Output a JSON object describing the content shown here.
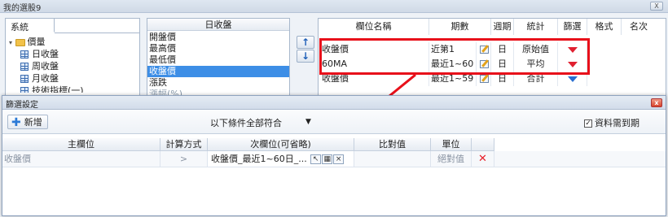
{
  "window": {
    "title": "我的選股9",
    "close_label": "X"
  },
  "left_panel": {
    "tab": "系統",
    "tree": [
      {
        "label": "價量",
        "type": "folder",
        "expanded": true
      },
      {
        "label": "日收盤",
        "type": "table"
      },
      {
        "label": "周收盤",
        "type": "table"
      },
      {
        "label": "月收盤",
        "type": "table"
      },
      {
        "label": "技術指標(一)",
        "type": "table"
      }
    ]
  },
  "middle_panel": {
    "header": "日收盤",
    "items": [
      "開盤價",
      "最高價",
      "最低價",
      "收盤價",
      "漲跌",
      "漲幅(%)"
    ],
    "selected": "收盤價"
  },
  "move_buttons": {
    "up": "↑",
    "down": "↓"
  },
  "right_panel": {
    "columns": [
      "欄位名稱",
      "期數",
      "週期",
      "統計",
      "篩選",
      "格式",
      "名次"
    ],
    "rows": [
      {
        "name": "收盤價",
        "period": "近第1",
        "cycle": "日",
        "stat": "原始值",
        "filter": "red"
      },
      {
        "name": "60MA",
        "period": "最近1~60",
        "cycle": "日",
        "stat": "平均",
        "filter": "red"
      },
      {
        "name": "收盤價",
        "period": "最近1~59",
        "cycle": "日",
        "stat": "合計",
        "filter": "blue"
      }
    ]
  },
  "dialog": {
    "title": "篩選設定",
    "close_label": "x",
    "add_label": "新增",
    "condition_select": "以下條件全部符合",
    "require_expiry_checked": true,
    "require_expiry_label": "資料需到期",
    "grid_headers": [
      "主欄位",
      "計算方式",
      "次欄位(可省略)",
      "比對值",
      "單位"
    ],
    "rows": [
      {
        "main": "收盤價",
        "op": ">",
        "sub": "收盤價_最近1~60日_...",
        "compare": "",
        "unit": "絕對值"
      }
    ]
  },
  "colors": {
    "highlight": "#e8101a",
    "accent": "#3d8ee6"
  }
}
